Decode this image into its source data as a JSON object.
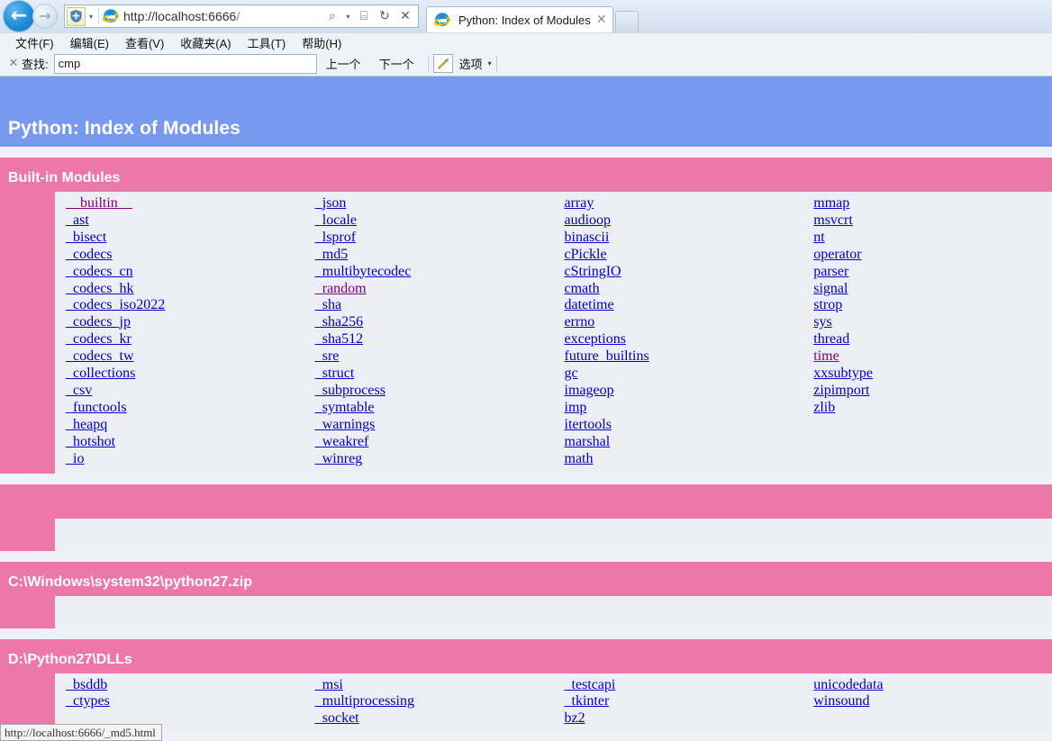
{
  "browser": {
    "back_label": "←",
    "forward_label": "→",
    "shield_label": "+",
    "shield_caret": "▾",
    "url_scheme": "http://",
    "url_host": "localhost:6666",
    "url_path": "/",
    "url_full": "http://localhost:6666/",
    "search_icon": "⌕",
    "search_caret": "▾",
    "compat_icon": "⌸",
    "refresh_icon": "↻",
    "stop_icon": "✕",
    "tab": {
      "title": "Python: Index of Modules",
      "close_label": "✕"
    },
    "menu": [
      {
        "label": "文件(F)"
      },
      {
        "label": "编辑(E)"
      },
      {
        "label": "查看(V)"
      },
      {
        "label": "收藏夹(A)"
      },
      {
        "label": "工具(T)"
      },
      {
        "label": "帮助(H)"
      }
    ],
    "findbar": {
      "close_label": "✕",
      "label": "查找:",
      "value": "cmp",
      "placeholder": "",
      "previous_label": "上一个",
      "next_label": "下一个",
      "highlight_icon": "✎",
      "options_label": "选项",
      "options_caret": "▾"
    },
    "statusbar": {
      "text": "http://localhost:6666/_md5.html"
    }
  },
  "page": {
    "title": "Python: Index of Modules",
    "colors": {
      "banner_blue": "#7799ee",
      "section_pink": "#ee77aa",
      "background": "#f0f0f8",
      "link": "#0000cc",
      "link_visited": "#800080"
    },
    "sections": [
      {
        "title": "Built-in Modules",
        "columns": [
          [
            {
              "label": "__builtin__",
              "visited": true
            },
            {
              "label": "_ast",
              "visited": false
            },
            {
              "label": "_bisect",
              "visited": false
            },
            {
              "label": "_codecs",
              "visited": false
            },
            {
              "label": "_codecs_cn",
              "visited": false
            },
            {
              "label": "_codecs_hk",
              "visited": false
            },
            {
              "label": "_codecs_iso2022",
              "visited": false
            },
            {
              "label": "_codecs_jp",
              "visited": false
            },
            {
              "label": "_codecs_kr",
              "visited": false
            },
            {
              "label": "_codecs_tw",
              "visited": false
            },
            {
              "label": "_collections",
              "visited": false
            },
            {
              "label": "_csv",
              "visited": false
            },
            {
              "label": "_functools",
              "visited": false
            },
            {
              "label": "_heapq",
              "visited": false
            },
            {
              "label": "_hotshot",
              "visited": false
            },
            {
              "label": "_io",
              "visited": false
            }
          ],
          [
            {
              "label": "_json",
              "visited": false
            },
            {
              "label": "_locale",
              "visited": false
            },
            {
              "label": "_lsprof",
              "visited": false
            },
            {
              "label": "_md5",
              "visited": false
            },
            {
              "label": "_multibytecodec",
              "visited": false
            },
            {
              "label": "_random",
              "visited": true
            },
            {
              "label": "_sha",
              "visited": false
            },
            {
              "label": "_sha256",
              "visited": false
            },
            {
              "label": "_sha512",
              "visited": false
            },
            {
              "label": "_sre",
              "visited": false
            },
            {
              "label": "_struct",
              "visited": false
            },
            {
              "label": "_subprocess",
              "visited": false
            },
            {
              "label": "_symtable",
              "visited": false
            },
            {
              "label": "_warnings",
              "visited": false
            },
            {
              "label": "_weakref",
              "visited": false
            },
            {
              "label": "_winreg",
              "visited": false
            }
          ],
          [
            {
              "label": "array",
              "visited": false
            },
            {
              "label": "audioop",
              "visited": false
            },
            {
              "label": "binascii",
              "visited": false
            },
            {
              "label": "cPickle",
              "visited": false
            },
            {
              "label": "cStringIO",
              "visited": false
            },
            {
              "label": "cmath",
              "visited": false
            },
            {
              "label": "datetime",
              "visited": false
            },
            {
              "label": "errno",
              "visited": false
            },
            {
              "label": "exceptions",
              "visited": false
            },
            {
              "label": "future_builtins",
              "visited": false
            },
            {
              "label": "gc",
              "visited": false
            },
            {
              "label": "imageop",
              "visited": false
            },
            {
              "label": "imp",
              "visited": false
            },
            {
              "label": "itertools",
              "visited": false
            },
            {
              "label": "marshal",
              "visited": false
            },
            {
              "label": "math",
              "visited": false
            }
          ],
          [
            {
              "label": "mmap",
              "visited": false
            },
            {
              "label": "msvcrt",
              "visited": false
            },
            {
              "label": "nt",
              "visited": false
            },
            {
              "label": "operator",
              "visited": false
            },
            {
              "label": "parser",
              "visited": false
            },
            {
              "label": "signal",
              "visited": false
            },
            {
              "label": "strop",
              "visited": false
            },
            {
              "label": "sys",
              "visited": false
            },
            {
              "label": "thread",
              "visited": false
            },
            {
              "label": "time",
              "visited": true
            },
            {
              "label": "xxsubtype",
              "visited": false
            },
            {
              "label": "zipimport",
              "visited": false
            },
            {
              "label": "zlib",
              "visited": false
            }
          ]
        ]
      },
      {
        "title": "",
        "columns": [
          [],
          [],
          [],
          []
        ]
      },
      {
        "title": "C:\\Windows\\system32\\python27.zip",
        "columns": [
          [],
          [],
          [],
          []
        ]
      },
      {
        "title": "D:\\Python27\\DLLs",
        "columns": [
          [
            {
              "label": "_bsddb",
              "visited": false
            },
            {
              "label": "_ctypes",
              "visited": false
            }
          ],
          [
            {
              "label": "_msi",
              "visited": false
            },
            {
              "label": "_multiprocessing",
              "visited": false
            },
            {
              "label": "_socket",
              "visited": false
            }
          ],
          [
            {
              "label": "_testcapi",
              "visited": false
            },
            {
              "label": "_tkinter",
              "visited": false
            },
            {
              "label": "bz2",
              "visited": false
            }
          ],
          [
            {
              "label": "unicodedata",
              "visited": false
            },
            {
              "label": "winsound",
              "visited": false
            }
          ]
        ]
      }
    ]
  }
}
